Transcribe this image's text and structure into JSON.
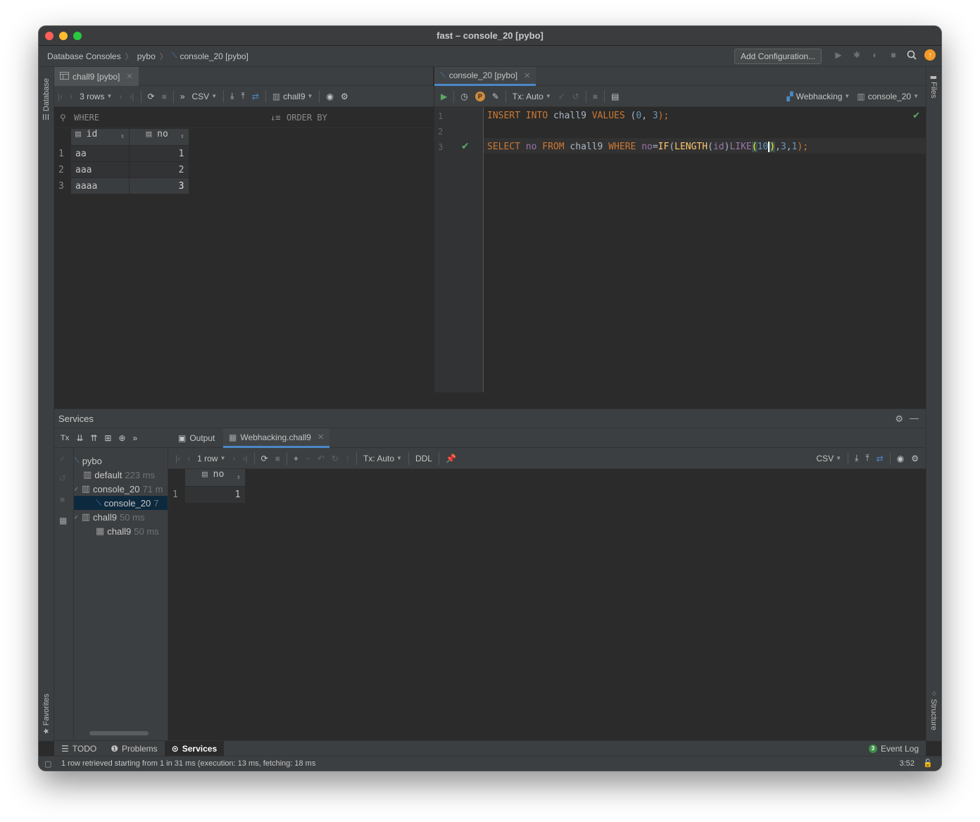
{
  "window": {
    "title": "fast – console_20 [pybo]"
  },
  "navbar": {
    "breadcrumbs": [
      "Database Consoles",
      "pybo",
      "console_20 [pybo]"
    ],
    "add_configuration": "Add Configuration..."
  },
  "side_panels": {
    "left_top": "Database",
    "left_bottom": "Favorites",
    "right_top": "Files",
    "right_bottom": "Structure"
  },
  "left_editor": {
    "tab": "chall9 [pybo]",
    "toolbar": {
      "rows": "3 rows",
      "format": "CSV",
      "datasource": "chall9"
    },
    "filter": {
      "where": "WHERE",
      "order_by": "ORDER BY"
    },
    "columns": [
      "id",
      "no"
    ],
    "rows": [
      {
        "num": "1",
        "id": "aa",
        "no": "1"
      },
      {
        "num": "2",
        "id": "aaa",
        "no": "2"
      },
      {
        "num": "3",
        "id": "aaaa",
        "no": "3"
      }
    ]
  },
  "right_editor": {
    "tab": "console_20 [pybo]",
    "toolbar": {
      "tx": "Tx: Auto",
      "schema": "Webhacking",
      "console": "console_20"
    },
    "line_numbers": [
      "1",
      "2",
      "3"
    ],
    "line1": {
      "insert": "INSERT",
      "into": "INTO",
      "table": "chall9",
      "values": "VALUES",
      "open": " (",
      "v1": "0",
      "comma": ", ",
      "v2": "3",
      "close": ");"
    },
    "line3": {
      "select": "SELECT",
      "col": "no",
      "from": "FROM",
      "table": "chall9",
      "where": "WHERE",
      "col2": "no",
      "eq": "=",
      "if": "IF",
      "p1": "(",
      "length": "LENGTH",
      "p2": "(",
      "arg": "id",
      "p3": ")",
      "like": "LIKE",
      "p4": "(",
      "lit_a": "10",
      "p5": ")",
      "c1": ",",
      "n3": "3",
      "c2": ",",
      "n1": "1",
      "p6": ");"
    }
  },
  "services": {
    "title": "Services",
    "tree": [
      {
        "label": "pybo",
        "meta": ""
      },
      {
        "label": "default",
        "meta": "223 ms"
      },
      {
        "label": "console_20",
        "meta": "71 m"
      },
      {
        "label": "console_20",
        "meta": "7"
      },
      {
        "label": "chall9",
        "meta": "50 ms"
      },
      {
        "label": "chall9",
        "meta": "50 ms"
      }
    ],
    "tabs": {
      "output": "Output",
      "result": "Webhacking.chall9"
    },
    "toolbar": {
      "rows": "1 row",
      "tx": "Tx: Auto",
      "ddl": "DDL",
      "format": "CSV"
    },
    "result_column": "no",
    "result_rows": [
      {
        "num": "1",
        "no": "1"
      }
    ]
  },
  "bottom_tools": {
    "todo": "TODO",
    "problems": "Problems",
    "services": "Services",
    "event_count": "3",
    "event_log": "Event Log"
  },
  "status": {
    "message": "1 row retrieved starting from 1 in 31 ms (execution: 13 ms, fetching: 18 ms",
    "time": "3:52"
  }
}
